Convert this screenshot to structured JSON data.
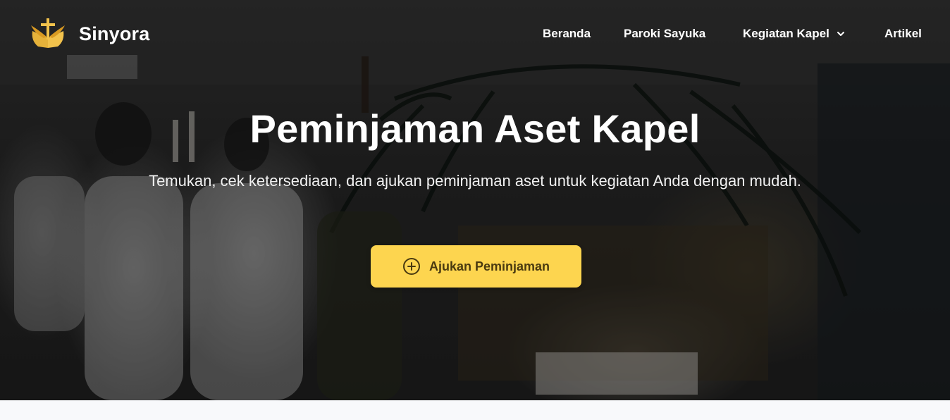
{
  "navbar": {
    "brand_name": "Sinyora",
    "logo_icon": "cross-book-wings-icon",
    "links": [
      {
        "label": "Beranda"
      },
      {
        "label": "Paroki Sayuka"
      },
      {
        "label": "Kegiatan Kapel",
        "has_dropdown": true
      },
      {
        "label": "Artikel"
      }
    ]
  },
  "hero": {
    "title": "Peminjaman Aset Kapel",
    "subtitle": "Temukan, cek ketersediaan, dan ajukan peminjaman aset untuk kegiatan Anda dengan mudah.",
    "cta_label": "Ajukan Peminjaman",
    "cta_icon": "plus-circle-icon",
    "background_image": "chapel-nativity-scene-photo"
  },
  "colors": {
    "accent": "#fdd54f",
    "accent_text": "#4a3a10",
    "logo_gold": "#e6b23a",
    "nav_text": "#ffffff"
  }
}
